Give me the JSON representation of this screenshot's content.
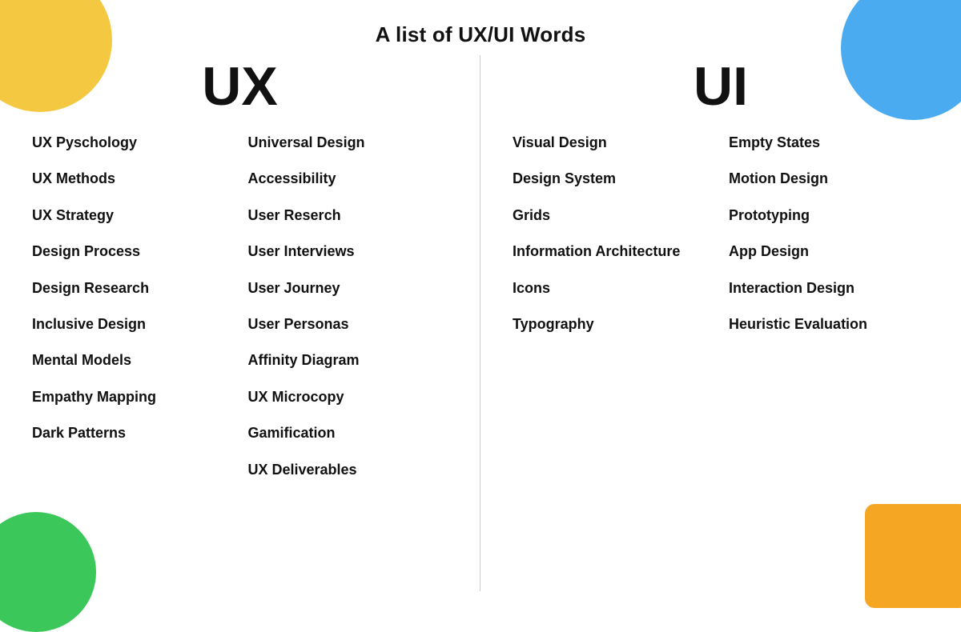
{
  "title": "A list of UX/UI Words",
  "ux_heading": "UX",
  "ui_heading": "UI",
  "ux_col1": [
    "UX Pyschology",
    "UX Methods",
    "UX Strategy",
    "Design Process",
    "Design Research",
    "Inclusive Design",
    "Mental Models",
    "Empathy Mapping",
    "Dark Patterns"
  ],
  "ux_col2": [
    "Universal Design",
    "Accessibility",
    "User Reserch",
    "User Interviews",
    "User Journey",
    "User Personas",
    "Affinity Diagram",
    "UX Microcopy",
    "Gamification",
    "UX Deliverables"
  ],
  "ui_col1": [
    "Visual Design",
    "Design System",
    "Grids",
    "Information Architecture",
    "Icons",
    "Typography"
  ],
  "ui_col2": [
    "Empty States",
    "Motion Design",
    "Prototyping",
    "App Design",
    "Interaction Design",
    "Heuristic Evaluation"
  ],
  "decorations": {
    "yellow": "#F5C842",
    "blue": "#4AABF0",
    "green": "#3CC75A",
    "orange": "#F5A623"
  }
}
